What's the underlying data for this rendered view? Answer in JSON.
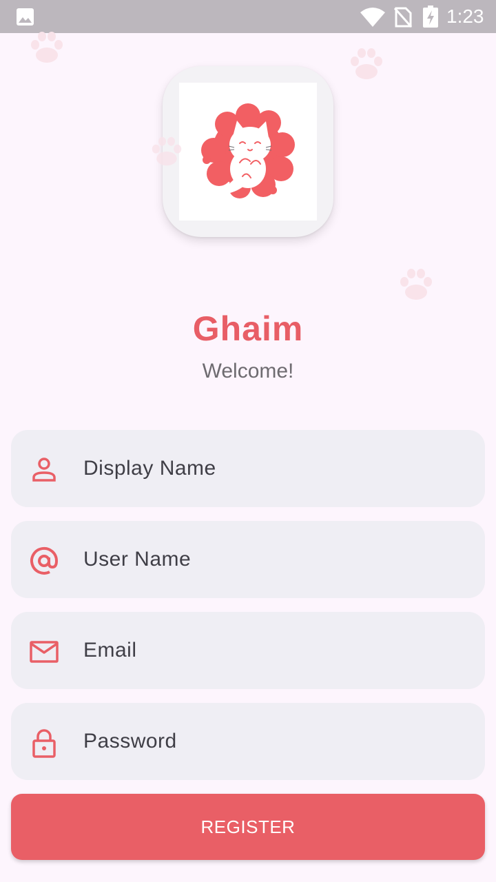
{
  "status_bar": {
    "time": "1:23"
  },
  "app": {
    "title": "Ghaim",
    "subtitle": "Welcome!"
  },
  "form": {
    "display_name": {
      "placeholder": "Display Name",
      "icon": "person-icon"
    },
    "user_name": {
      "placeholder": "User Name",
      "icon": "at-icon"
    },
    "email": {
      "placeholder": "Email",
      "icon": "mail-icon"
    },
    "password": {
      "placeholder": "Password",
      "icon": "lock-icon"
    },
    "register_label": "REGISTER"
  },
  "colors": {
    "accent": "#e95f66",
    "background": "#fdf5fd",
    "field_bg": "#efeef4",
    "status_bar": "#bcb7bd"
  }
}
